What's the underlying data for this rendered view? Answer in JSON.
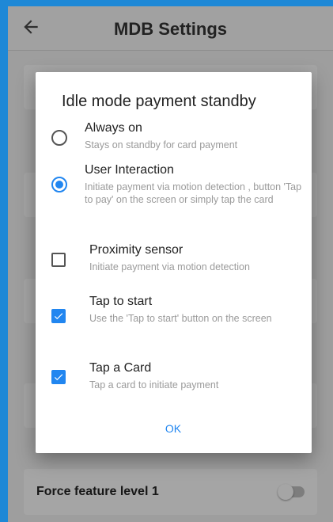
{
  "appbar": {
    "title": "MDB Settings",
    "back_icon": "arrow-left-icon"
  },
  "background": {
    "row_label": "Force feature level 1",
    "toggle_on": false
  },
  "dialog": {
    "title": "Idle mode payment standby",
    "ok_label": "OK",
    "options": [
      {
        "type": "radio",
        "checked": false,
        "label": "Always on",
        "desc": "Stays on standby for card payment"
      },
      {
        "type": "radio",
        "checked": true,
        "label": "User Interaction",
        "desc": "Initiate payment via motion detection , button 'Tap to pay' on the screen or simply tap the card"
      },
      {
        "type": "checkbox",
        "checked": false,
        "label": "Proximity sensor",
        "desc": "Initiate payment via motion detection"
      },
      {
        "type": "checkbox",
        "checked": true,
        "label": "Tap to start",
        "desc": "Use the 'Tap to start' button on the screen"
      },
      {
        "type": "checkbox",
        "checked": true,
        "label": "Tap a Card",
        "desc": "Tap a card to initiate payment"
      }
    ]
  },
  "colors": {
    "accent": "#2186f0",
    "frame": "#1e88d6"
  }
}
